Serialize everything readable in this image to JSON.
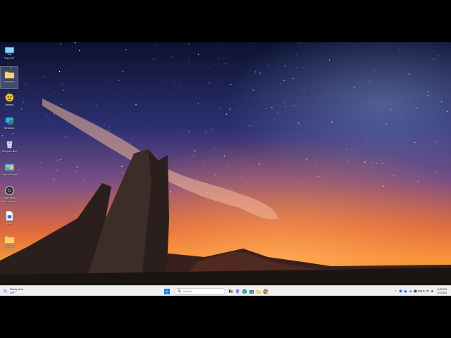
{
  "desktop": {
    "icons": [
      {
        "label": "This PC",
        "icon": "computer-icon"
      },
      {
        "label": "ocolumn",
        "icon": "folder-icon"
      },
      {
        "label": "Dewey",
        "icon": "app-icon"
      },
      {
        "label": "Network",
        "icon": "network-icon"
      },
      {
        "label": "Recycle Bin",
        "icon": "recycle-bin-icon"
      },
      {
        "label": "Control Panel",
        "icon": "control-panel-icon"
      },
      {
        "label": "Learn about this picture",
        "icon": "camera-icon"
      },
      {
        "label": "tidal",
        "icon": "document-icon"
      },
      {
        "label": "_projects",
        "icon": "folder-icon"
      }
    ]
  },
  "taskbar": {
    "weather": {
      "line1": "Mainly clear",
      "line2": "63°F"
    },
    "search_placeholder": "Search",
    "apps": [
      "file-explorer-icon",
      "copilot-icon",
      "edge-icon",
      "store-icon",
      "folder-icon",
      "chrome-icon"
    ],
    "tray": {
      "chevron": "^",
      "language": "ENG",
      "time": "8:36 PM",
      "date": "7/1/2024"
    }
  },
  "colors": {
    "taskbar_bg": "#eeeff3",
    "sky_top": "#0d1330",
    "sky_mid": "#3b3a7a",
    "horizon": "#f07b2e",
    "rock": "#2a1f1c"
  }
}
